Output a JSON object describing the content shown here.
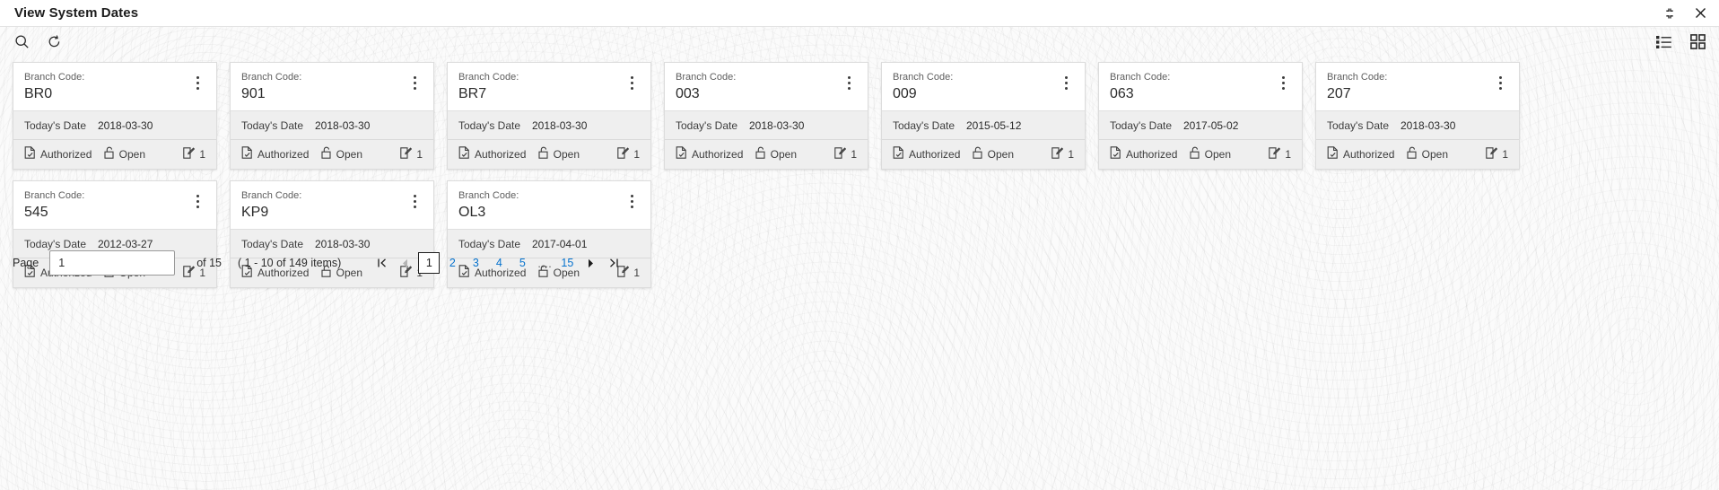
{
  "window": {
    "title": "View System Dates",
    "controls": [
      {
        "name": "minimize-restore-icon",
        "label": "Restore"
      },
      {
        "name": "close-icon",
        "label": "Close"
      }
    ]
  },
  "toolbar": {
    "left": [
      {
        "name": "search-icon",
        "label": "Search"
      },
      {
        "name": "refresh-icon",
        "label": "Refresh"
      }
    ],
    "right": [
      {
        "name": "list-view-icon",
        "label": "List View"
      },
      {
        "name": "tile-view-icon",
        "label": "Tile View"
      }
    ]
  },
  "card_fields": {
    "branch_code_label": "Branch Code:",
    "todays_date_label": "Today's Date",
    "menu_label": "More options"
  },
  "cards": [
    {
      "branch_code": "BR0",
      "todays_date": "2018-03-30",
      "auth_status": "Authorized",
      "lock_status": "Open",
      "mod_count": "1"
    },
    {
      "branch_code": "901",
      "todays_date": "2018-03-30",
      "auth_status": "Authorized",
      "lock_status": "Open",
      "mod_count": "1"
    },
    {
      "branch_code": "BR7",
      "todays_date": "2018-03-30",
      "auth_status": "Authorized",
      "lock_status": "Open",
      "mod_count": "1"
    },
    {
      "branch_code": "003",
      "todays_date": "2018-03-30",
      "auth_status": "Authorized",
      "lock_status": "Open",
      "mod_count": "1"
    },
    {
      "branch_code": "009",
      "todays_date": "2015-05-12",
      "auth_status": "Authorized",
      "lock_status": "Open",
      "mod_count": "1"
    },
    {
      "branch_code": "063",
      "todays_date": "2017-05-02",
      "auth_status": "Authorized",
      "lock_status": "Open",
      "mod_count": "1"
    },
    {
      "branch_code": "207",
      "todays_date": "2018-03-30",
      "auth_status": "Authorized",
      "lock_status": "Open",
      "mod_count": "1"
    },
    {
      "branch_code": "545",
      "todays_date": "2012-03-27",
      "auth_status": "Authorized",
      "lock_status": "Open",
      "mod_count": "1"
    },
    {
      "branch_code": "KP9",
      "todays_date": "2018-03-30",
      "auth_status": "Authorized",
      "lock_status": "Open",
      "mod_count": "1"
    },
    {
      "branch_code": "OL3",
      "todays_date": "2017-04-01",
      "auth_status": "Authorized",
      "lock_status": "Open",
      "mod_count": "1"
    }
  ],
  "pagination": {
    "page_label": "Page",
    "page_value": "1",
    "of_text": "of 15",
    "items_text": "( 1 - 10 of 149 items)",
    "pages": [
      "1",
      "2",
      "3",
      "4",
      "5"
    ],
    "ellipsis": "....",
    "last_page": "15",
    "current_page": "1",
    "first_arrow": "first-page-icon",
    "prev_arrow": "previous-page-icon",
    "next_arrow": "next-page-icon",
    "last_arrow": "last-page-icon"
  },
  "colors": {
    "link": "#0572ce",
    "card_body_bg": "#efefef",
    "page_bg": "#fbfbfb"
  }
}
